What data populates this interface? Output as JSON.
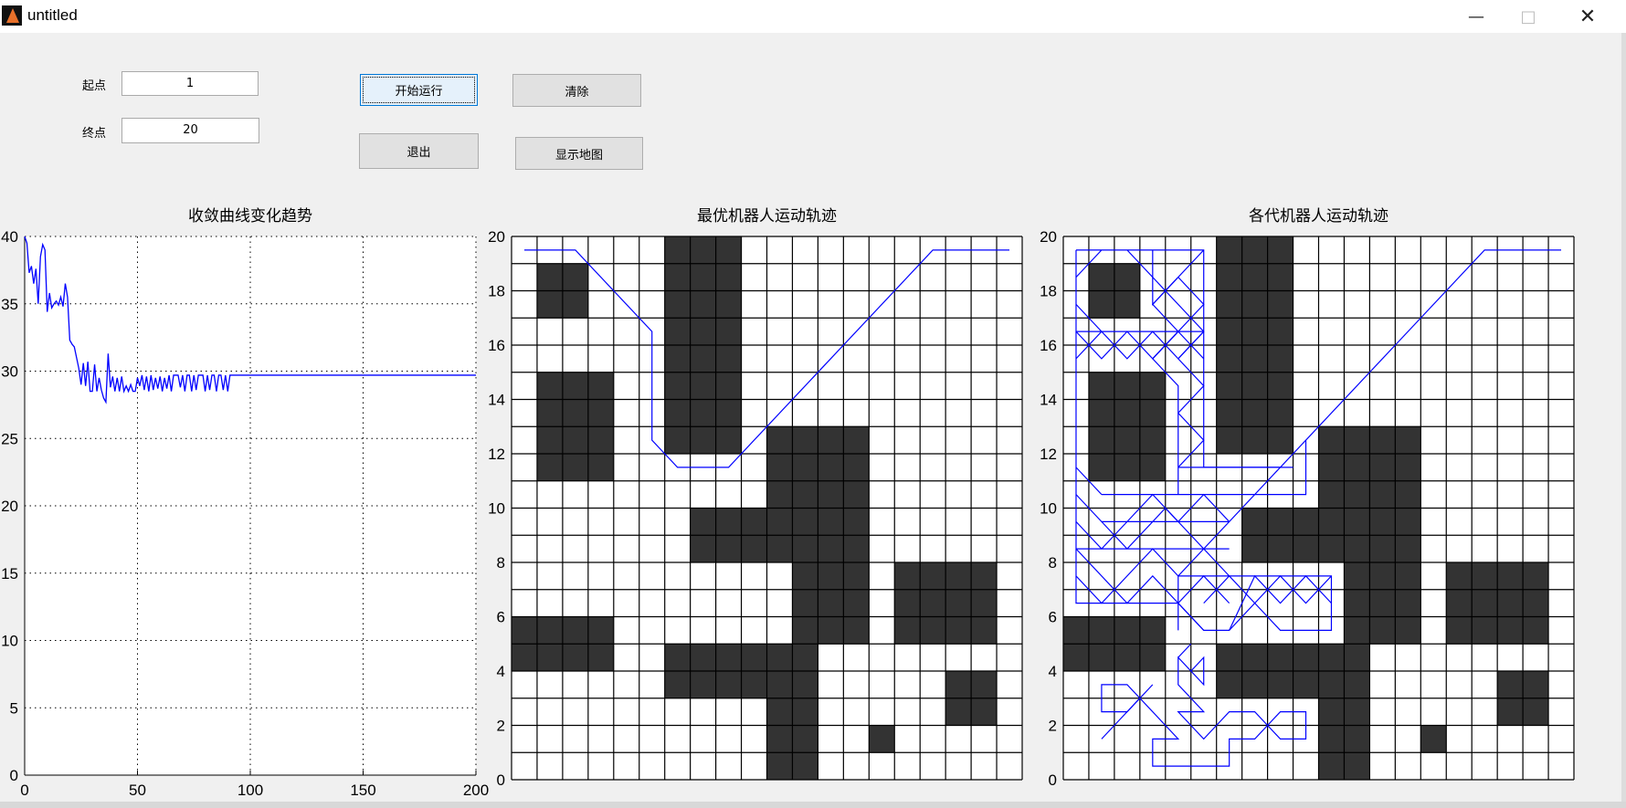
{
  "window": {
    "title": "untitled",
    "minimize_icon": "minimize-icon",
    "maximize_icon": "maximize-icon",
    "close_icon": "close-icon"
  },
  "controls": {
    "start_label": "起点",
    "start_value": "1",
    "end_label": "终点",
    "end_value": "20",
    "run_button": "开始运行",
    "clear_button": "清除",
    "exit_button": "退出",
    "show_map_button": "显示地图"
  },
  "colors": {
    "line": "#0000ff",
    "obstacle": "#333333",
    "grid": "#000000"
  },
  "chart_data": [
    {
      "type": "line",
      "title": "收敛曲线变化趋势",
      "xlim": [
        0,
        200
      ],
      "ylim": [
        0,
        40
      ],
      "xticks": [
        0,
        50,
        100,
        150,
        200
      ],
      "yticks": [
        0,
        5,
        10,
        15,
        20,
        25,
        30,
        35,
        40
      ],
      "grid": "dotted",
      "x": [
        0,
        1,
        2,
        3,
        4,
        5,
        6,
        7,
        8,
        9,
        10,
        11,
        12,
        13,
        14,
        15,
        16,
        17,
        18,
        19,
        20,
        21,
        22,
        23,
        24,
        25,
        26,
        27,
        28,
        29,
        30,
        31,
        32,
        33,
        34,
        35,
        36,
        37,
        38,
        39,
        40,
        41,
        42,
        43,
        44,
        45,
        46,
        47,
        48,
        49,
        50,
        51,
        52,
        53,
        54,
        55,
        56,
        57,
        58,
        59,
        60,
        61,
        62,
        63,
        64,
        65,
        66,
        67,
        68,
        69,
        70,
        71,
        72,
        73,
        74,
        75,
        76,
        77,
        78,
        79,
        80,
        81,
        82,
        83,
        84,
        85,
        86,
        87,
        88,
        89,
        90,
        91,
        92,
        200
      ],
      "y": [
        40,
        39.5,
        37.3,
        37.8,
        36.5,
        37.6,
        35.0,
        38.5,
        39.4,
        39.0,
        34.4,
        35.8,
        34.7,
        35.0,
        35.2,
        34.9,
        35.5,
        34.8,
        36.5,
        35.5,
        32.3,
        32.0,
        31.8,
        31.0,
        30.2,
        29.0,
        30.6,
        28.9,
        30.7,
        28.5,
        28.5,
        30.5,
        28.5,
        29.5,
        28.6,
        28.0,
        27.7,
        31.3,
        28.8,
        29.6,
        28.5,
        29.5,
        28.5,
        29.6,
        28.5,
        28.9,
        28.5,
        29.0,
        28.5,
        28.5,
        29.5,
        28.9,
        29.7,
        28.6,
        29.6,
        28.5,
        29.7,
        28.6,
        29.5,
        28.7,
        29.6,
        28.5,
        29.5,
        28.7,
        29.7,
        28.5,
        29.7,
        29.7,
        29.7,
        28.8,
        29.7,
        28.5,
        29.7,
        29.7,
        28.5,
        29.7,
        28.6,
        29.7,
        29.7,
        29.7,
        28.5,
        29.7,
        28.6,
        29.7,
        29.7,
        28.5,
        29.7,
        29.7,
        28.6,
        29.7,
        28.5,
        29.7,
        29.7,
        29.7
      ]
    },
    {
      "type": "grid-map",
      "title": "最优机器人运动轨迹",
      "xlim": [
        0,
        20
      ],
      "ylim": [
        0,
        20
      ],
      "yticks": [
        0,
        2,
        4,
        6,
        8,
        10,
        12,
        14,
        16,
        18,
        20
      ],
      "obstacles": [
        [
          1,
          17,
          3,
          19
        ],
        [
          6,
          12,
          9,
          20
        ],
        [
          1,
          11,
          4,
          15
        ],
        [
          10,
          8,
          14,
          13
        ],
        [
          7,
          8,
          10,
          10
        ],
        [
          11,
          5,
          14,
          8
        ],
        [
          0,
          4,
          4,
          6
        ],
        [
          6,
          3,
          12,
          5
        ],
        [
          10,
          0,
          12,
          3
        ],
        [
          14,
          1,
          15,
          2
        ],
        [
          15,
          5,
          19,
          8
        ],
        [
          17,
          2,
          19,
          4
        ]
      ],
      "paths": [
        [
          [
            0.5,
            19.5
          ],
          [
            2.5,
            19.5
          ],
          [
            5.5,
            16.5
          ],
          [
            5.5,
            12.5
          ],
          [
            6.5,
            11.5
          ],
          [
            8.5,
            11.5
          ],
          [
            16.5,
            19.5
          ],
          [
            19.5,
            19.5
          ]
        ]
      ]
    },
    {
      "type": "grid-map",
      "title": "各代机器人运动轨迹",
      "xlim": [
        0,
        20
      ],
      "ylim": [
        0,
        20
      ],
      "yticks": [
        0,
        2,
        4,
        6,
        8,
        10,
        12,
        14,
        16,
        18,
        20
      ],
      "obstacles": [
        [
          1,
          17,
          3,
          19
        ],
        [
          6,
          12,
          9,
          20
        ],
        [
          1,
          11,
          4,
          15
        ],
        [
          10,
          8,
          14,
          13
        ],
        [
          7,
          8,
          10,
          10
        ],
        [
          11,
          5,
          14,
          8
        ],
        [
          0,
          4,
          4,
          6
        ],
        [
          6,
          3,
          12,
          5
        ],
        [
          10,
          0,
          12,
          3
        ],
        [
          14,
          1,
          15,
          2
        ],
        [
          15,
          5,
          19,
          8
        ],
        [
          17,
          2,
          19,
          4
        ]
      ],
      "paths": [
        [
          [
            0.5,
            19.5
          ],
          [
            5.5,
            19.5
          ],
          [
            5.5,
            11.5
          ],
          [
            8.5,
            11.5
          ],
          [
            16.5,
            19.5
          ],
          [
            19.5,
            19.5
          ]
        ],
        [
          [
            0.5,
            19.5
          ],
          [
            0.5,
            6.5
          ],
          [
            4.5,
            6.5
          ],
          [
            4.5,
            5.5
          ]
        ],
        [
          [
            0.5,
            16.5
          ],
          [
            5.5,
            16.5
          ]
        ],
        [
          [
            0.5,
            15.5
          ],
          [
            1.5,
            16.5
          ],
          [
            2.5,
            15.5
          ],
          [
            3.5,
            16.5
          ],
          [
            4.5,
            15.5
          ],
          [
            5.5,
            16.5
          ]
        ],
        [
          [
            0.5,
            16.5
          ],
          [
            1.5,
            15.5
          ],
          [
            2.5,
            16.5
          ],
          [
            3.5,
            15.5
          ],
          [
            4.5,
            16.5
          ],
          [
            5.5,
            15.5
          ]
        ],
        [
          [
            2.5,
            19.5
          ],
          [
            5.5,
            16.5
          ],
          [
            4.5,
            15.5
          ],
          [
            5.5,
            14.5
          ],
          [
            4.5,
            13.5
          ],
          [
            5.5,
            12.5
          ],
          [
            4.5,
            11.5
          ]
        ],
        [
          [
            5.5,
            19.5
          ],
          [
            3.5,
            17.5
          ],
          [
            4.5,
            16.5
          ],
          [
            3.5,
            15.5
          ],
          [
            4.5,
            14.5
          ],
          [
            4.5,
            10.5
          ]
        ],
        [
          [
            3.5,
            19.5
          ],
          [
            3.5,
            17.5
          ],
          [
            4.5,
            18.5
          ],
          [
            5.5,
            17.5
          ],
          [
            3.5,
            15.5
          ]
        ],
        [
          [
            0.5,
            18.5
          ],
          [
            1.5,
            19.5
          ]
        ],
        [
          [
            0.5,
            17.5
          ],
          [
            1.5,
            16.5
          ]
        ],
        [
          [
            1.5,
            10.5
          ],
          [
            9.5,
            10.5
          ],
          [
            9.5,
            12.5
          ]
        ],
        [
          [
            4.5,
            11.5
          ],
          [
            9,
            11.5
          ]
        ],
        [
          [
            0.5,
            11.5
          ],
          [
            1.5,
            10.5
          ]
        ],
        [
          [
            0.5,
            10.5
          ],
          [
            1.5,
            9.5
          ],
          [
            2.5,
            8.5
          ],
          [
            4,
            10
          ],
          [
            5.5,
            8.5
          ],
          [
            6.5,
            9.5
          ]
        ],
        [
          [
            0.5,
            9.5
          ],
          [
            1.5,
            8.5
          ],
          [
            2.5,
            9.5
          ],
          [
            3.5,
            10.5
          ],
          [
            4.5,
            9.5
          ],
          [
            5.5,
            10.5
          ],
          [
            6.5,
            9.5
          ],
          [
            8.5,
            11.5
          ]
        ],
        [
          [
            1.5,
            9.5
          ],
          [
            6.5,
            9.5
          ]
        ],
        [
          [
            0.5,
            8.5
          ],
          [
            6.5,
            8.5
          ]
        ],
        [
          [
            0.5,
            8.5
          ],
          [
            2.5,
            6.5
          ],
          [
            3.5,
            7.5
          ],
          [
            4.5,
            6.5
          ],
          [
            5.5,
            7.5
          ],
          [
            6.5,
            6.5
          ]
        ],
        [
          [
            0.5,
            7.5
          ],
          [
            1.5,
            6.5
          ],
          [
            2.5,
            7.5
          ],
          [
            3.5,
            8.5
          ],
          [
            4.5,
            7.5
          ],
          [
            5.5,
            8.5
          ],
          [
            6.5,
            7.5
          ]
        ],
        [
          [
            4.5,
            7.5
          ],
          [
            10.5,
            7.5
          ],
          [
            10.5,
            5.5
          ],
          [
            8.5,
            5.5
          ],
          [
            7.5,
            6.5
          ],
          [
            6.5,
            5.5
          ],
          [
            5.5,
            5.5
          ],
          [
            4.5,
            6.5
          ]
        ],
        [
          [
            5.5,
            5.5
          ],
          [
            4.5,
            6.5
          ],
          [
            4.5,
            7.5
          ]
        ],
        [
          [
            6.5,
            7.5
          ],
          [
            7.5,
            6.5
          ],
          [
            8.5,
            7.5
          ],
          [
            9.5,
            6.5
          ],
          [
            10.5,
            7.5
          ]
        ],
        [
          [
            6.5,
            5.5
          ],
          [
            7.5,
            7.5
          ],
          [
            8.5,
            6.5
          ],
          [
            9.5,
            7.5
          ],
          [
            10.5,
            6.5
          ]
        ],
        [
          [
            5.5,
            6.5
          ],
          [
            6.5,
            7.5
          ]
        ],
        [
          [
            5,
            5
          ],
          [
            4.5,
            4.5
          ],
          [
            5,
            4
          ],
          [
            5.5,
            4.5
          ],
          [
            5.5,
            3.5
          ],
          [
            4.5,
            4.5
          ],
          [
            4.5,
            3.5
          ],
          [
            5.5,
            2.5
          ],
          [
            4.5,
            2.5
          ],
          [
            5.5,
            1.5
          ],
          [
            6,
            2
          ],
          [
            6.5,
            2.5
          ],
          [
            7.5,
            2.5
          ],
          [
            8,
            2
          ],
          [
            8.5,
            2.5
          ],
          [
            9.5,
            2.5
          ],
          [
            9.5,
            1.5
          ],
          [
            8.5,
            1.5
          ],
          [
            8,
            2
          ],
          [
            7.5,
            1.5
          ],
          [
            6.5,
            1.5
          ],
          [
            6.5,
            0.5
          ],
          [
            3.5,
            0.5
          ],
          [
            3.5,
            1.5
          ],
          [
            4.5,
            1.5
          ],
          [
            3,
            3
          ],
          [
            1.5,
            1.5
          ]
        ],
        [
          [
            3,
            3
          ],
          [
            3.5,
            3.5
          ]
        ],
        [
          [
            3,
            3
          ],
          [
            2.5,
            3.5
          ],
          [
            1.5,
            3.5
          ],
          [
            1.5,
            2.5
          ],
          [
            2.5,
            2.5
          ],
          [
            3,
            3
          ]
        ]
      ]
    }
  ]
}
